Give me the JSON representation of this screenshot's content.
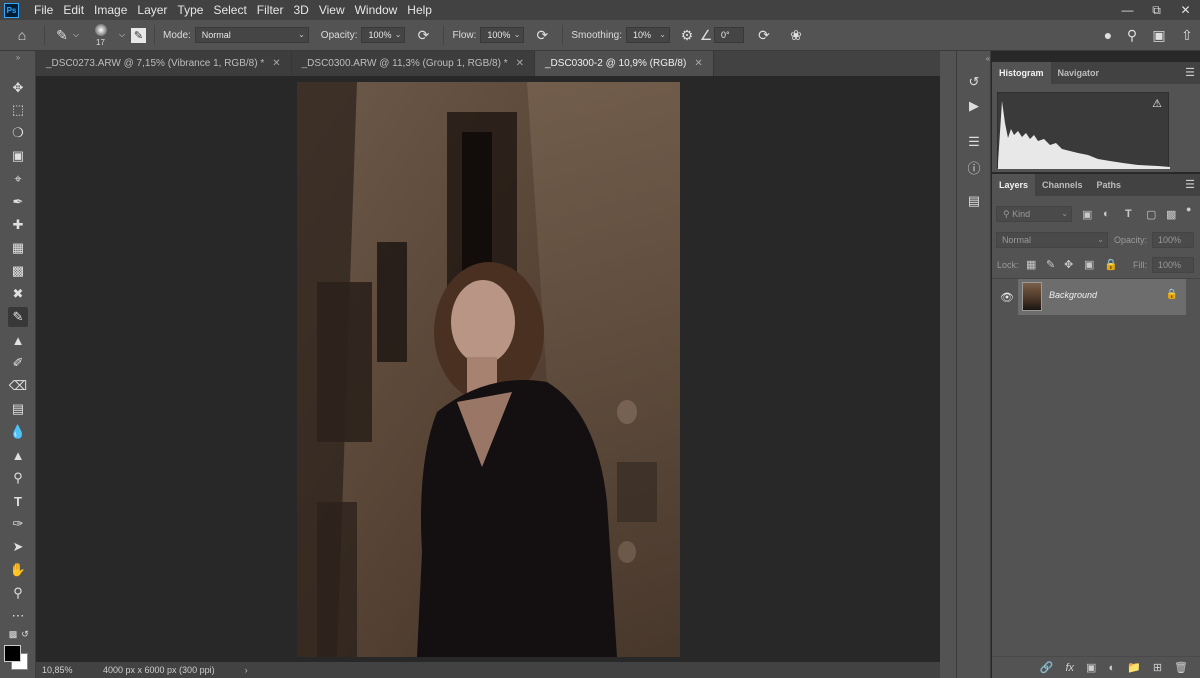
{
  "menu": [
    "File",
    "Edit",
    "Image",
    "Layer",
    "Type",
    "Select",
    "Filter",
    "3D",
    "View",
    "Window",
    "Help"
  ],
  "app_logo": "Ps",
  "options": {
    "brush_size": "17",
    "mode_label": "Mode:",
    "mode_value": "Normal",
    "opacity_label": "Opacity:",
    "opacity_value": "100%",
    "flow_label": "Flow:",
    "flow_value": "100%",
    "smoothing_label": "Smoothing:",
    "smoothing_value": "10%",
    "angle_value": "0°"
  },
  "tabs": [
    {
      "label": "_DSC0273.ARW @ 7,15% (Vibrance 1, RGB/8) *"
    },
    {
      "label": "_DSC0300.ARW @ 11,3% (Group 1, RGB/8) *"
    },
    {
      "label": "_DSC0300-2 @ 10,9% (RGB/8)"
    }
  ],
  "status": {
    "zoom": "10,85%",
    "doc_info": "4000 px x 6000 px (300 ppi)"
  },
  "histogram_panel": {
    "tabs": [
      "Histogram",
      "Navigator"
    ],
    "warning_icon": "warning-icon"
  },
  "layers_panel": {
    "tabs": [
      "Layers",
      "Channels",
      "Paths"
    ],
    "kind_placeholder": "Kind",
    "blend_mode": "Normal",
    "opacity_label": "Opacity:",
    "opacity_value": "100%",
    "lock_label": "Lock:",
    "fill_label": "Fill:",
    "fill_value": "100%",
    "layer_name": "Background"
  },
  "colors": {
    "accent": "#31a8ff",
    "panel_bg": "#535353",
    "canvas_bg": "#282828"
  }
}
